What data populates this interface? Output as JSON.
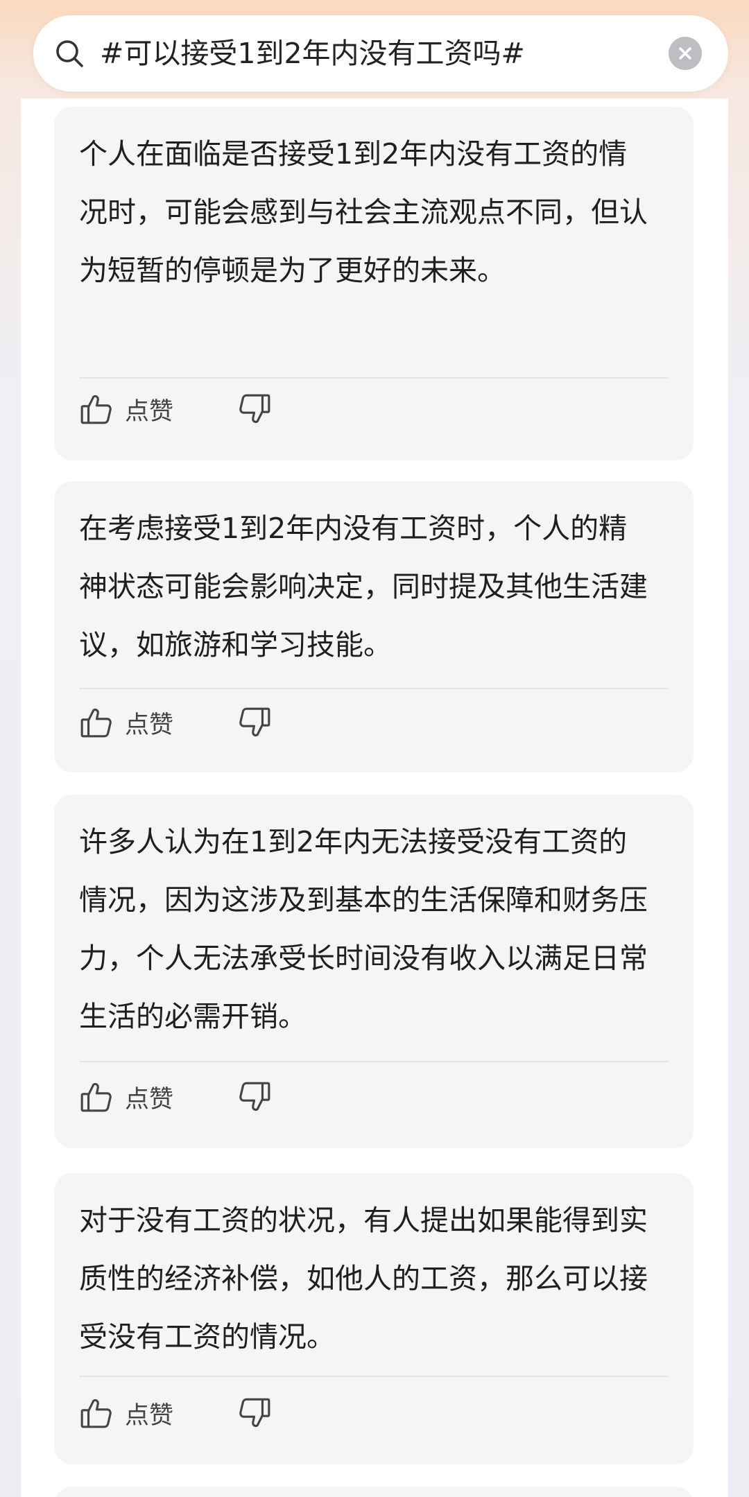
{
  "search": {
    "query": "#可以接受1到2年内没有工资吗#"
  },
  "like_label": "点赞",
  "cards": [
    {
      "text": "个人在面临是否接受1到2年内没有工资的情况时，可能会感到与社会主流观点不同，但认为短暂的停顿是为了更好的未来。"
    },
    {
      "text": "在考虑接受1到2年内没有工资时，个人的精神状态可能会影响决定，同时提及其他生活建议，如旅游和学习技能。"
    },
    {
      "text": "许多人认为在1到2年内无法接受没有工资的情况，因为这涉及到基本的生活保障和财务压力，个人无法承受长时间没有收入以满足日常生活的必需开销。"
    },
    {
      "text": "对于没有工资的状况，有人提出如果能得到实质性的经济补偿，如他人的工资，那么可以接受没有工资的情况。"
    }
  ],
  "icons": {
    "search": "search-icon",
    "clear": "close-icon",
    "like": "thumbs-up-icon",
    "dislike": "thumbs-down-icon"
  }
}
